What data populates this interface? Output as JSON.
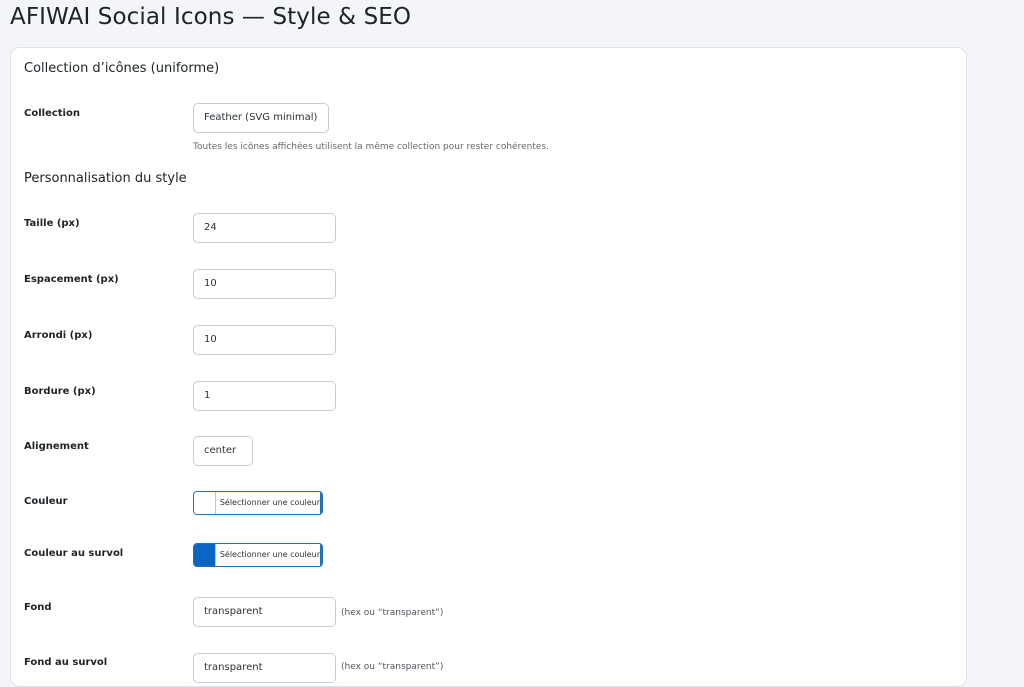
{
  "page": {
    "title": "AFIWAI Social Icons — Style & SEO"
  },
  "collection_section": {
    "title": "Collection d’icônes (uniforme)",
    "collection_label": "Collection",
    "collection_value": "Feather (SVG minimal)",
    "collection_desc": "Toutes les icônes affichées utilisent la même collection pour rester cohérentes."
  },
  "style_section": {
    "title": "Personnalisation du style",
    "size_label": "Taille (px)",
    "size_value": "24",
    "spacing_label": "Espacement (px)",
    "spacing_value": "10",
    "radius_label": "Arrondi (px)",
    "radius_value": "10",
    "border_label": "Bordure (px)",
    "border_value": "1",
    "align_label": "Alignement",
    "align_value": "center",
    "color_label": "Couleur",
    "color_button": "Sélectionner une couleur",
    "color_swatch": "#ffffff",
    "hover_color_label": "Couleur au survol",
    "hover_color_button": "Sélectionner une couleur",
    "hover_color_swatch": "#0a66c2",
    "bg_label": "Fond",
    "bg_value": "transparent",
    "bg_hint": "(hex ou “transparent”)",
    "bg_hover_label": "Fond au survol",
    "bg_hover_value": "transparent",
    "bg_hover_hint": "(hex ou “transparent”)"
  }
}
